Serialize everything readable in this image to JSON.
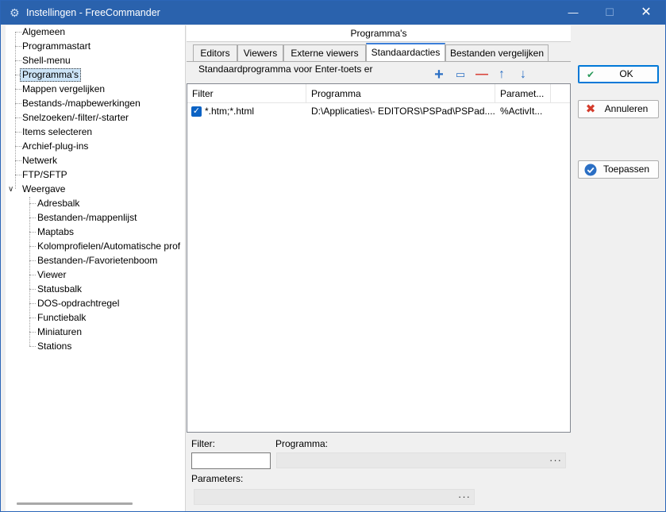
{
  "window": {
    "title": "Instellingen - FreeCommander",
    "minimize": "—",
    "maximize": "☐",
    "close": "✕"
  },
  "tree": {
    "items": [
      {
        "label": "Algemeen"
      },
      {
        "label": "Programmastart"
      },
      {
        "label": "Shell-menu"
      },
      {
        "label": "Programma's",
        "selected": true
      },
      {
        "label": "Mappen vergelijken"
      },
      {
        "label": "Bestands-/mapbewerkingen"
      },
      {
        "label": "Snelzoeken/-filter/-starter"
      },
      {
        "label": "Items selecteren"
      },
      {
        "label": "Archief-plug-ins"
      },
      {
        "label": "Netwerk"
      },
      {
        "label": "FTP/SFTP"
      },
      {
        "label": "Weergave",
        "expanded": true
      }
    ],
    "children": [
      {
        "label": "Adresbalk"
      },
      {
        "label": "Bestanden-/mappenlijst"
      },
      {
        "label": "Maptabs"
      },
      {
        "label": "Kolomprofielen/Automatische prof"
      },
      {
        "label": "Bestanden-/Favorietenboom"
      },
      {
        "label": "Viewer"
      },
      {
        "label": "Statusbalk"
      },
      {
        "label": "DOS-opdrachtregel"
      },
      {
        "label": "Functiebalk"
      },
      {
        "label": "Miniaturen"
      },
      {
        "label": "Stations"
      }
    ]
  },
  "panel": {
    "title": "Programma's",
    "tabs": [
      "Editors",
      "Viewers",
      "Externe viewers",
      "Standaardacties",
      "Bestanden vergelijken"
    ],
    "active_tab": "Standaardacties",
    "section_label": "Standaardprogramma voor Enter-toets er"
  },
  "toolbar": {
    "add": "+",
    "edit": "▭",
    "remove": "—",
    "up": "↑",
    "down": "↓"
  },
  "grid": {
    "columns": [
      "Filter",
      "Programma",
      "Paramet..."
    ],
    "rows": [
      {
        "checked": true,
        "filter": "*.htm;*.html",
        "program": "D:\\Applicaties\\- EDITORS\\PSPad\\PSPad....",
        "params": "%ActivIt..."
      }
    ]
  },
  "form": {
    "filter_label": "Filter:",
    "program_label": "Programma:",
    "parameters_label": "Parameters:",
    "filter_value": "",
    "program_value": "",
    "parameters_value": "",
    "ellipsis": "···"
  },
  "buttons": {
    "ok": "OK",
    "cancel": "Annuleren",
    "apply": "Toepassen"
  },
  "colors": {
    "titlebar": "#2a62ad",
    "ok_check": "#2a9a5a",
    "cancel_x": "#d43b2b",
    "apply_icon": "#2b6fc4",
    "toolbar_blue": "#2b6fc4",
    "toolbar_red": "#d9433a"
  }
}
